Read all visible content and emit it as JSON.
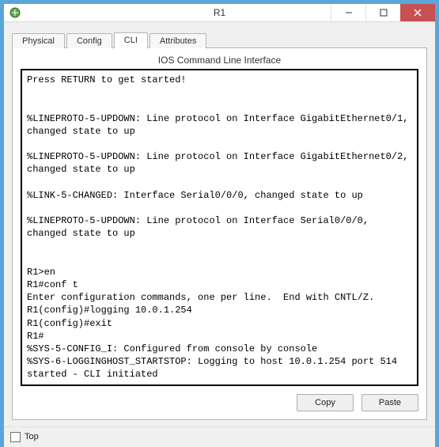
{
  "window": {
    "title": "R1"
  },
  "tabs": {
    "items": [
      {
        "label": "Physical"
      },
      {
        "label": "Config"
      },
      {
        "label": "CLI"
      },
      {
        "label": "Attributes"
      }
    ],
    "active_index": 2
  },
  "panel": {
    "title": "IOS Command Line Interface"
  },
  "terminal": {
    "text": "Press RETURN to get started!\n\n\n%LINEPROTO-5-UPDOWN: Line protocol on Interface GigabitEthernet0/1, changed state to up\n\n%LINEPROTO-5-UPDOWN: Line protocol on Interface GigabitEthernet0/2, changed state to up\n\n%LINK-5-CHANGED: Interface Serial0/0/0, changed state to up\n\n%LINEPROTO-5-UPDOWN: Line protocol on Interface Serial0/0/0, changed state to up\n\n\nR1>en\nR1#conf t\nEnter configuration commands, one per line.  End with CNTL/Z.\nR1(config)#logging 10.0.1.254\nR1(config)#exit\nR1#\n%SYS-5-CONFIG_I: Configured from console by console\n%SYS-6-LOGGINGHOST_STARTSTOP: Logging to host 10.0.1.254 port 514 started - CLI initiated\n"
  },
  "buttons": {
    "copy": "Copy",
    "paste": "Paste"
  },
  "footer": {
    "top_label": "Top",
    "top_checked": false
  }
}
